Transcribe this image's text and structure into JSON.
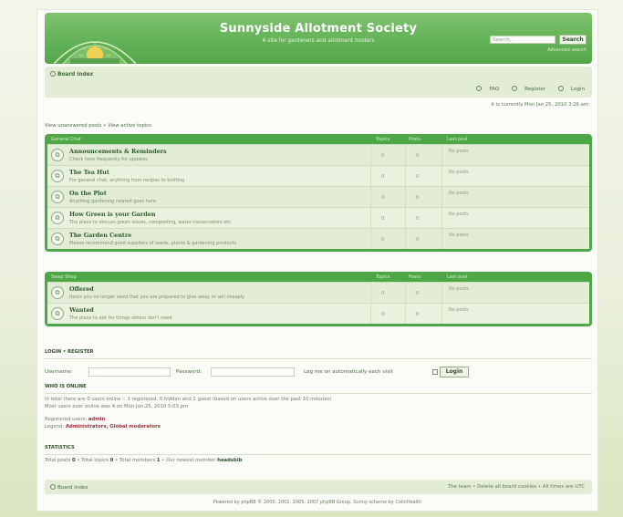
{
  "header": {
    "title": "Sunnyside Allotment Society",
    "description": "A site for gardeners and allotment holders",
    "search_placeholder": "Search...",
    "search_button": "Search",
    "advanced_search": "Advanced search"
  },
  "nav": {
    "board_index": "Board index",
    "faq": "FAQ",
    "register": "Register",
    "login": "Login",
    "datetime": "It is currently Mon Jan 25, 2010 3:26 am"
  },
  "view_links": "View unanswered posts • View active topics",
  "forum_group_1": {
    "header": "General Chat",
    "col_topics": "Topics",
    "col_posts": "Posts",
    "col_last": "Last post",
    "forums": [
      {
        "title": "Announcements & Reminders",
        "desc": "Check here frequently for updates",
        "topics": "0",
        "posts": "0",
        "last": "No posts"
      },
      {
        "title": "The Tea Hut",
        "desc": "For general chat, anything from recipes to knitting",
        "topics": "0",
        "posts": "0",
        "last": "No posts"
      },
      {
        "title": "On the Plot",
        "desc": "Anything gardening related goes here",
        "topics": "0",
        "posts": "0",
        "last": "No posts"
      },
      {
        "title": "How Green is your Garden",
        "desc": "The place to discuss green issues, composting, water conservation etc",
        "topics": "0",
        "posts": "0",
        "last": "No posts"
      },
      {
        "title": "The Garden Centre",
        "desc": "Please recommend good suppliers of seeds, plants & gardening products",
        "topics": "0",
        "posts": "0",
        "last": "No posts"
      }
    ]
  },
  "forum_group_2": {
    "header": "Swap Shop",
    "col_topics": "Topics",
    "col_posts": "Posts",
    "col_last": "Last post",
    "forums": [
      {
        "title": "Offered",
        "desc": "Items you no longer need that you are prepared to give away or sell cheaply",
        "topics": "0",
        "posts": "0",
        "last": "No posts"
      },
      {
        "title": "Wanted",
        "desc": "The place to ask for things others don't need",
        "topics": "0",
        "posts": "0",
        "last": "No posts"
      }
    ]
  },
  "login": {
    "title": "LOGIN • REGISTER",
    "username_label": "Username:",
    "password_label": "Password:",
    "auto_login": "Log me on automatically each visit",
    "button": "Login"
  },
  "online": {
    "title": "WHO IS ONLINE",
    "line1": "In total there are 0 users online :: 1 registered, 0 hidden and 1 guest (based on users active over the past 10 minutes)",
    "line2": "Most users ever online was 4 on Mon Jan 25, 2010 5:03 pm",
    "registered_label": "Registered users:",
    "registered_user": "admin",
    "legend_label": "Legend:",
    "legend_values": "Administrators, Global moderators"
  },
  "stats": {
    "title": "STATISTICS",
    "text_prefix": "Total posts",
    "posts": "0",
    "topics_label": "Total topics",
    "topics": "0",
    "members_label": "Total members",
    "members": "1",
    "newest_label": "Our newest member",
    "newest": "headsbib"
  },
  "footer": {
    "board_index": "Board index",
    "right": "The team • Delete all board cookies • All times are UTC",
    "copyright": "Powered by phpBB © 2000, 2002, 2005, 2007 phpBB Group. Sunny scheme by ColinHealth"
  },
  "colors": {
    "header_green": "#63b257",
    "box_green": "#4ea746",
    "row_bg": "#eaf2df",
    "accent_red": "#a0303a"
  }
}
